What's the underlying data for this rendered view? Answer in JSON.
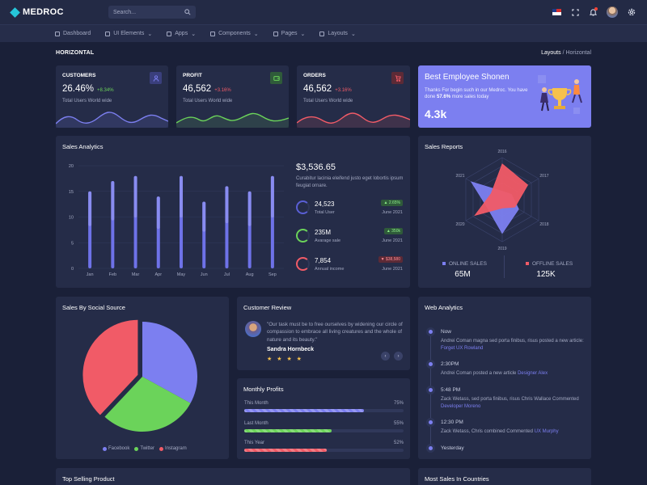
{
  "brand": {
    "name": "MEDROC"
  },
  "search": {
    "placeholder": "Search..."
  },
  "menu": [
    "Dashboard",
    "UI Elements",
    "Apps",
    "Components",
    "Pages",
    "Layouts"
  ],
  "page": {
    "title": "HORIZONTAL",
    "breadcrumb_parent": "Layouts",
    "breadcrumb_sep": "/",
    "breadcrumb_current": "Horizontal"
  },
  "stats": [
    {
      "label": "CUSTOMERS",
      "value": "26.46%",
      "change": "+8.34%",
      "sub": "Total Users World wide",
      "color": "#7c7ff0",
      "icon": "user-icon"
    },
    {
      "label": "PROFIT",
      "value": "46,562",
      "change": "+3.16%",
      "sub": "Total Users World wide",
      "color": "#6bd35a",
      "icon": "wallet-icon"
    },
    {
      "label": "ORDERS",
      "value": "46,562",
      "change": "+3.16%",
      "sub": "Total Users World wide",
      "color": "#f15b67",
      "icon": "cart-icon"
    }
  ],
  "employee": {
    "title": "Best Employee Shonen",
    "desc_pre": "Thanks For begin such in our Medroc. You have done",
    "desc_bold": "57.6%",
    "desc_post": "more sales today",
    "value": "4.3k"
  },
  "sales_analytics": {
    "title": "Sales Analytics",
    "total": "$3,536.65",
    "desc": "Curabitur lacinia eleifend justo eget lobortis ipsum feugiat ornare.",
    "items": [
      {
        "value": "24,523",
        "label": "Total User",
        "badge": "2.65%",
        "date": "June 2021",
        "color": "#5a5fd6",
        "badge_bg": "#2f5b3a",
        "badge_fg": "#8ff08b"
      },
      {
        "value": "235M",
        "label": "Avarage sale",
        "badge": "350k",
        "date": "June 2021",
        "color": "#6bd35a",
        "badge_bg": "#2f5b3a",
        "badge_fg": "#8ff08b"
      },
      {
        "value": "7,854",
        "label": "Annual income",
        "badge": "$38,580",
        "date": "June 2021",
        "color": "#f15b67",
        "badge_bg": "#5c2a36",
        "badge_fg": "#ff8d96"
      }
    ]
  },
  "chart_data": [
    {
      "type": "bar",
      "title": "Sales Analytics",
      "categories": [
        "Jan",
        "Feb",
        "Mar",
        "Apr",
        "May",
        "Jun",
        "Jul",
        "Aug",
        "Sep"
      ],
      "values": [
        15,
        17,
        18,
        14,
        18,
        13,
        16,
        15,
        18
      ],
      "ylim": [
        0,
        20
      ],
      "yticks": [
        0,
        5,
        10,
        15,
        20
      ],
      "grid": true,
      "color": "#6e72e8"
    },
    {
      "type": "radar",
      "title": "Sales Reports",
      "axes": [
        "2016",
        "2017",
        "2018",
        "2019",
        "2020",
        "2021"
      ],
      "series": [
        {
          "name": "ONLINE SALES",
          "color": "#7c7ff0",
          "values": [
            20,
            25,
            45,
            80,
            40,
            85
          ]
        },
        {
          "name": "OFFLINE SALES",
          "color": "#f15b67",
          "values": [
            85,
            70,
            35,
            20,
            75,
            30
          ]
        }
      ],
      "totals": [
        "65M",
        "125K"
      ]
    },
    {
      "type": "pie",
      "title": "Sales By Social Source",
      "labels": [
        "Facebook",
        "Twitter",
        "Instagram"
      ],
      "values": [
        33,
        29,
        38
      ],
      "colors": [
        "#7c7ff0",
        "#6bd35a",
        "#f15b67"
      ]
    }
  ],
  "review": {
    "title": "Customer Review",
    "quote": "\"Our task must be to free ourselves by widening our circle of compassion to embrace all living creatures and the whole of nature and its beauty.\"",
    "name": "Sandra Hornbeck",
    "stars": "★ ★ ★ ★"
  },
  "monthly": {
    "title": "Monthly Profits",
    "rows": [
      {
        "label": "This Month",
        "pct": "75%",
        "fraction": 0.75,
        "color": "#7c7ff0"
      },
      {
        "label": "Last Month",
        "pct": "55%",
        "fraction": 0.55,
        "color": "#6bd35a"
      },
      {
        "label": "This Year",
        "pct": "52%",
        "fraction": 0.52,
        "color": "#f15b67"
      }
    ]
  },
  "web": {
    "title": "Web Analytics",
    "items": [
      {
        "time": "Now",
        "text": "Andrei Coman magna sed porta finibus, risus posted a new article:",
        "link": "Forget UX Rowland"
      },
      {
        "time": "2:30PM",
        "text": "Andrei Coman posted a new article",
        "link": "Designer Alex"
      },
      {
        "time": "5:48 PM",
        "text": "Zack Wetass, sed porta finibus, risus Chris Wallace Commented",
        "link": "Developer Moreno"
      },
      {
        "time": "12:30 PM",
        "text": "Zack Wetass, Chris combined Commented",
        "link": "UX Murphy"
      },
      {
        "time": "Yesterday",
        "text": "",
        "link": ""
      }
    ]
  },
  "bottom": {
    "left_title": "Top Selling Product",
    "right_title": "Most Sales In Countries"
  }
}
